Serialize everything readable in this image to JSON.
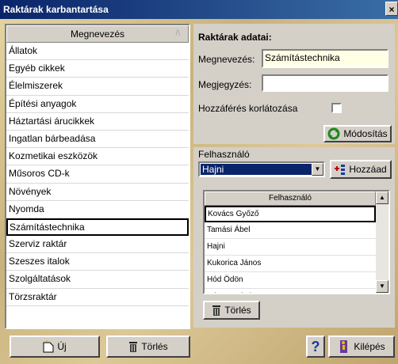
{
  "window": {
    "title": "Raktárak karbantartása",
    "close_glyph": "×"
  },
  "list": {
    "header": "Megnevezés",
    "sort_glyph": "/\\",
    "items": [
      {
        "label": "Állatok"
      },
      {
        "label": "Egyéb cikkek"
      },
      {
        "label": "Élelmiszerek"
      },
      {
        "label": "Építési anyagok"
      },
      {
        "label": "Háztartási árucikkek"
      },
      {
        "label": "Ingatlan bárbeadása"
      },
      {
        "label": "Kozmetikai eszközök"
      },
      {
        "label": "Műsoros CD-k"
      },
      {
        "label": "Növények"
      },
      {
        "label": "Nyomda"
      },
      {
        "label": "Számítástechnika"
      },
      {
        "label": "Szerviz raktár"
      },
      {
        "label": "Szeszes italok"
      },
      {
        "label": "Szolgáltatások"
      },
      {
        "label": "Törzsraktár"
      }
    ],
    "selected_index": 10
  },
  "details": {
    "title": "Raktárak adatai:",
    "name_label": "Megnevezés:",
    "name_value": "Számítástechnika",
    "note_label": "Megjegyzés:",
    "note_value": "",
    "restrict_label": "Hozzáférés korlátozása",
    "restrict_checked": false,
    "modify_button": "Módosítás"
  },
  "users": {
    "group_label": "Felhasználó",
    "selected_user": "Hajni",
    "add_button": "Hozzáad",
    "grid_header": "Felhasználó",
    "rows": [
      {
        "name": "Kovács Győző"
      },
      {
        "name": "Tamási Ábel"
      },
      {
        "name": "Hajni"
      },
      {
        "name": "Kukorica János"
      },
      {
        "name": "Hód Ödön"
      },
      {
        "name": "Három Jakab"
      }
    ],
    "selected_row": 0,
    "delete_button": "Törlés"
  },
  "footer": {
    "new_button": "Új",
    "delete_button": "Törlés",
    "help_glyph": "?",
    "exit_button": "Kilépés"
  },
  "colors": {
    "title_bar": "#0a246a",
    "panel": "#d4d0c8",
    "input_bg": "#ffffe6",
    "selection": "#0a246a"
  }
}
